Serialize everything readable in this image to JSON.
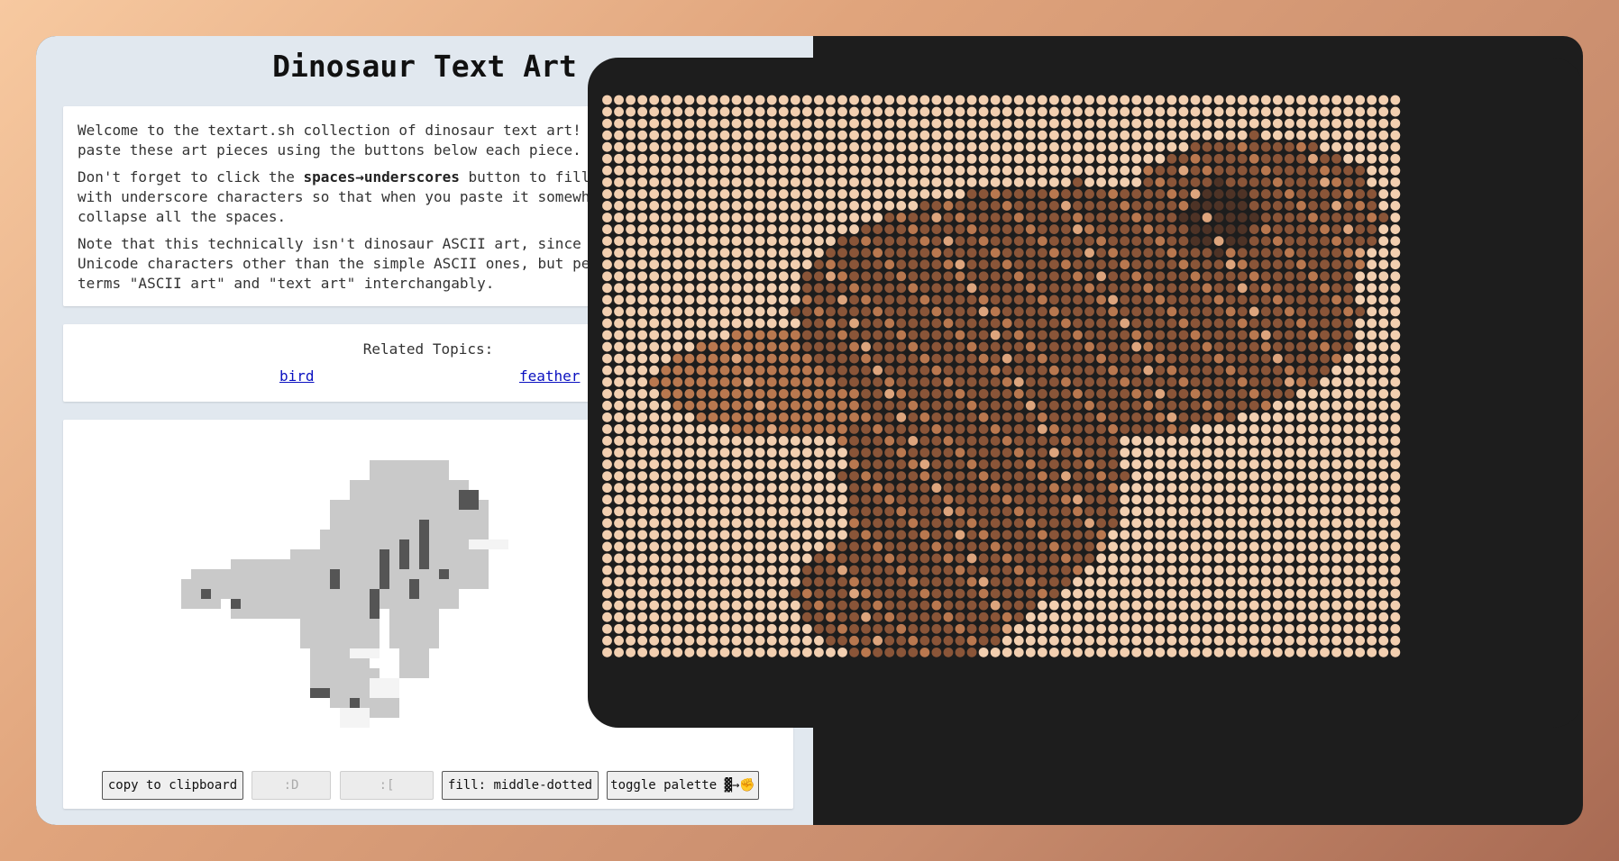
{
  "page": {
    "title": "Dinosaur Text Art"
  },
  "intro": {
    "p1_line1": "Welcome to the textart.sh collection of dinosaur text art! You",
    "p1_line2": "paste these art pieces using the buttons below each piece.",
    "p2_line1_a": "Don't forget to click the ",
    "p2_line1_bold": "spaces→underscores",
    "p2_line1_b": " button to fill th",
    "p2_line2": "with underscore characters so that when you paste it somewhere",
    "p2_line3": "collapse all the spaces.",
    "p3_line1": "Note that this technically isn't dinosaur ASCII art, since it",
    "p3_line2": "Unicode characters other than the simple ASCII ones, but peopl",
    "p3_line3": "terms \"ASCII art\" and \"text art\" interchangably."
  },
  "related": {
    "label": "Related Topics:",
    "links": [
      "bird",
      "feather"
    ]
  },
  "buttons": {
    "copy": "copy to clipboard",
    "smile": ":D",
    "sad": ":[",
    "fill": "fill: middle-dotted",
    "toggle": "toggle palette ▓→✊"
  },
  "colors": {
    "page_bg": "#e1e8ef",
    "link": "#0a10c0",
    "dark_panel": "#1d1d1d",
    "skin_light": "#f2cfb0",
    "skin_medium_light": "#dda57d",
    "skin_medium": "#b9784f",
    "skin_medium_dark": "#8a5538",
    "skin_dark": "#4e3326"
  },
  "icons": {
    "emoji_cell": "raised-fist-emoji"
  }
}
